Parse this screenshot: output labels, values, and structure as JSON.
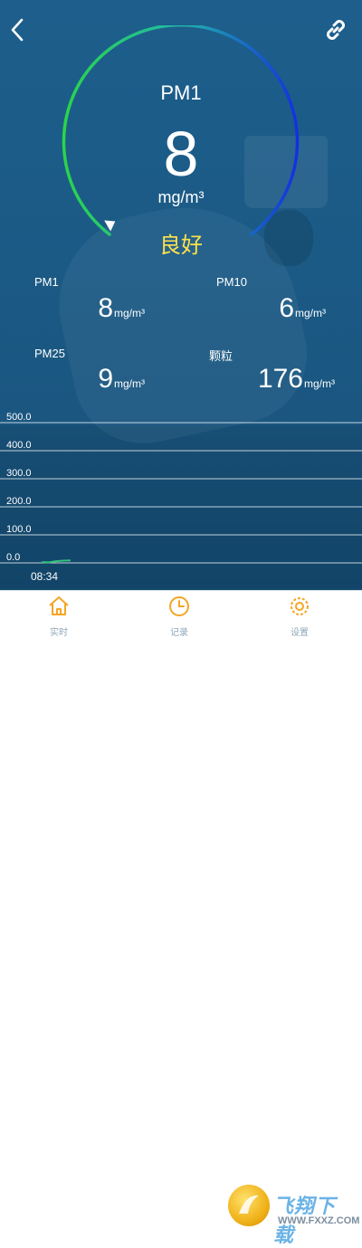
{
  "gauge": {
    "label": "PM1",
    "value": "8",
    "unit": "mg/m³",
    "status": "良好"
  },
  "metrics": [
    {
      "label": "PM1",
      "value": "8",
      "unit": "mg/m³"
    },
    {
      "label": "PM10",
      "value": "6",
      "unit": "mg/m³"
    },
    {
      "label": "PM25",
      "value": "9",
      "unit": "mg/m³"
    },
    {
      "label": "颗粒",
      "value": "176",
      "unit": "mg/m³"
    }
  ],
  "chart_data": {
    "type": "line",
    "y_ticks": [
      "500.0",
      "400.0",
      "300.0",
      "200.0",
      "100.0",
      "0.0"
    ],
    "ylim": [
      0,
      500
    ],
    "x_ticks": [
      "08:34"
    ],
    "series": [
      {
        "values": [
          3,
          2,
          6,
          8,
          9
        ]
      }
    ],
    "line_color": "#31c27c",
    "grid": true
  },
  "tabs": [
    {
      "label": "实时",
      "icon": "home-icon"
    },
    {
      "label": "记录",
      "icon": "clock-icon"
    },
    {
      "label": "设置",
      "icon": "gear-icon"
    }
  ],
  "watermark": {
    "text": "飞翔下载",
    "url": "WWW.FXXZ.COM"
  },
  "colors": {
    "background": "#1b5a85",
    "status": "#ffe24a",
    "gauge_start": "#2bd44a",
    "gauge_end": "#1330e0"
  }
}
